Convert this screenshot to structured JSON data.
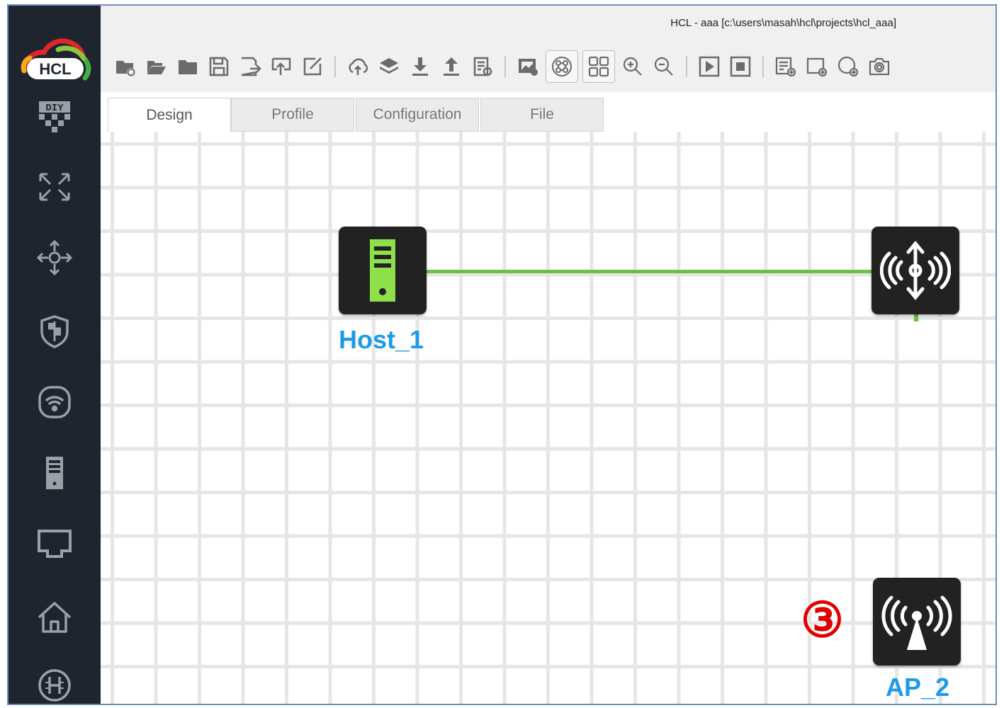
{
  "window": {
    "title": "HCL - aaa [c:\\users\\masah\\hcl\\projects\\hcl_aaa]"
  },
  "logo": {
    "text": "HCL"
  },
  "sidebar": {
    "items": [
      {
        "name": "diy",
        "icon": "diy-icon",
        "text": "DIY"
      },
      {
        "name": "router",
        "icon": "router-icon"
      },
      {
        "name": "switch",
        "icon": "switch-icon"
      },
      {
        "name": "firewall",
        "icon": "shield-icon"
      },
      {
        "name": "wireless",
        "icon": "wifi-icon"
      },
      {
        "name": "host",
        "icon": "host-icon"
      },
      {
        "name": "cloud",
        "icon": "network-port-icon"
      },
      {
        "name": "home",
        "icon": "home-icon"
      },
      {
        "name": "hub",
        "icon": "h-circle-icon"
      }
    ]
  },
  "toolbar": {
    "buttons": [
      "new-project-icon",
      "open-project-icon",
      "folder-icon",
      "save-icon",
      "save-as-icon",
      "export-icon",
      "edit-icon",
      "cloud-upload-icon",
      "layers-icon",
      "download-icon",
      "upload-icon",
      "log-icon",
      "screenshot-icon",
      "topology-icon",
      "grid-icon",
      "zoom-in-icon",
      "zoom-out-icon",
      "start-icon",
      "stop-icon",
      "add-note-icon",
      "add-rectangle-icon",
      "add-ellipse-icon",
      "camera-icon"
    ]
  },
  "tabs": [
    {
      "label": "Design",
      "active": true
    },
    {
      "label": "Profile",
      "active": false
    },
    {
      "label": "Configuration",
      "active": false
    },
    {
      "label": "File",
      "active": false
    }
  ],
  "canvas": {
    "nodes": [
      {
        "id": "host",
        "label": "Host_1",
        "icon": "host-icon"
      },
      {
        "id": "ac",
        "label": "",
        "icon": "wireless-controller-icon"
      },
      {
        "id": "ap",
        "label": "AP_2",
        "icon": "access-point-icon"
      }
    ],
    "annotation": "③",
    "colors": {
      "link": "#6cc144",
      "label": "#1e9be8",
      "marker": "#e00000"
    }
  }
}
